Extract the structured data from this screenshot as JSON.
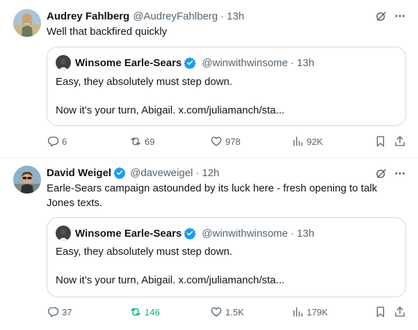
{
  "colors": {
    "accent": "#1d9bf0",
    "muted": "#536471",
    "retweet_active": "#00ba7c",
    "border": "#cfd9de"
  },
  "tweets": [
    {
      "author_name": "Audrey Fahlberg",
      "author_handle": "@AudreyFahlberg",
      "time": "13h",
      "verified": false,
      "text": "Well that backfired quickly",
      "quote": {
        "author_name": "Winsome Earle-Sears",
        "author_handle": "@winwithwinsome",
        "time": "13h",
        "line1": "Easy, they absolutely must step down.",
        "line2": "Now it’s your turn, Abigail. x.com/juliamanch/sta..."
      },
      "stats": {
        "replies": "6",
        "reposts": "69",
        "likes": "978",
        "views": "92K",
        "reposted": false
      }
    },
    {
      "author_name": "David Weigel",
      "author_handle": "@daveweigel",
      "time": "12h",
      "verified": true,
      "text_line1": "Earle-Sears campaign astounded by its luck here - fresh opening to talk",
      "text_line2": "Jones texts.",
      "quote": {
        "author_name": "Winsome Earle-Sears",
        "author_handle": "@winwithwinsome",
        "time": "13h",
        "line1": "Easy, they absolutely must step down.",
        "line2": "Now it’s your turn, Abigail. x.com/juliamanch/sta..."
      },
      "stats": {
        "replies": "37",
        "reposts": "146",
        "likes": "1.5K",
        "views": "179K",
        "reposted": true
      }
    }
  ],
  "separator": "·"
}
